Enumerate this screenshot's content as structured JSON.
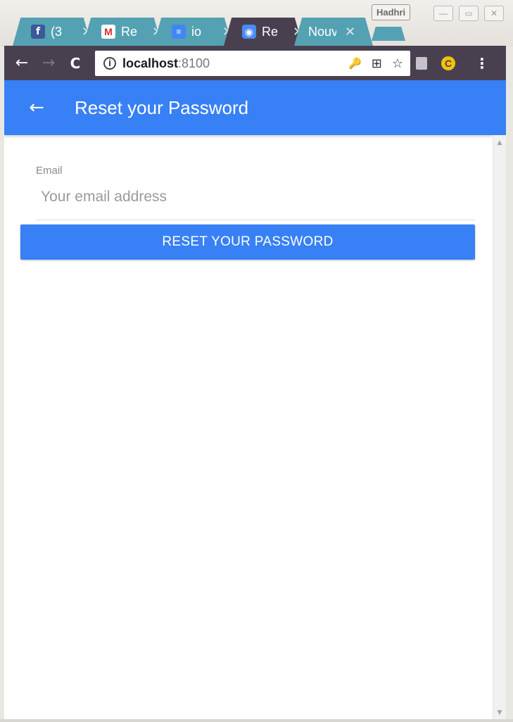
{
  "browser": {
    "profile_name": "Hadhri",
    "window_controls": {
      "minimize": "—",
      "maximize": "▭",
      "close": "✕"
    },
    "tabs": [
      {
        "title": "(3",
        "icon": "facebook-icon",
        "favicon_glyph": "f",
        "active": false
      },
      {
        "title": "Re",
        "icon": "gmail-icon",
        "favicon_glyph": "M",
        "active": false
      },
      {
        "title": "io",
        "icon": "docs-icon",
        "favicon_glyph": "≡",
        "active": false
      },
      {
        "title": "Re",
        "icon": "ionic-icon",
        "favicon_glyph": "◉",
        "active": true
      },
      {
        "title": "Nouv",
        "icon": "",
        "favicon_glyph": "",
        "active": false
      }
    ],
    "tab_close_glyph": "✕",
    "toolbar": {
      "back_glyph": "←",
      "forward_glyph": "→",
      "reload_glyph": "C",
      "info_glyph": "i",
      "url_host": "localhost",
      "url_port": ":8100",
      "key_glyph": "🔑",
      "translate_glyph": "⊞",
      "star_glyph": "☆",
      "extension_glyph": "C",
      "menu_glyph": "⋮"
    },
    "colors": {
      "tab": "#55a1b4",
      "active_tab": "#49404f",
      "toolbar": "#49404f"
    }
  },
  "app": {
    "header": {
      "back_glyph": "←",
      "title": "Reset your Password",
      "color": "#3880f5"
    },
    "form": {
      "email_label": "Email",
      "email_placeholder": "Your email address",
      "email_value": "",
      "submit_label": "RESET YOUR PASSWORD"
    }
  },
  "scrollbar": {
    "up_glyph": "▲",
    "down_glyph": "▼"
  }
}
